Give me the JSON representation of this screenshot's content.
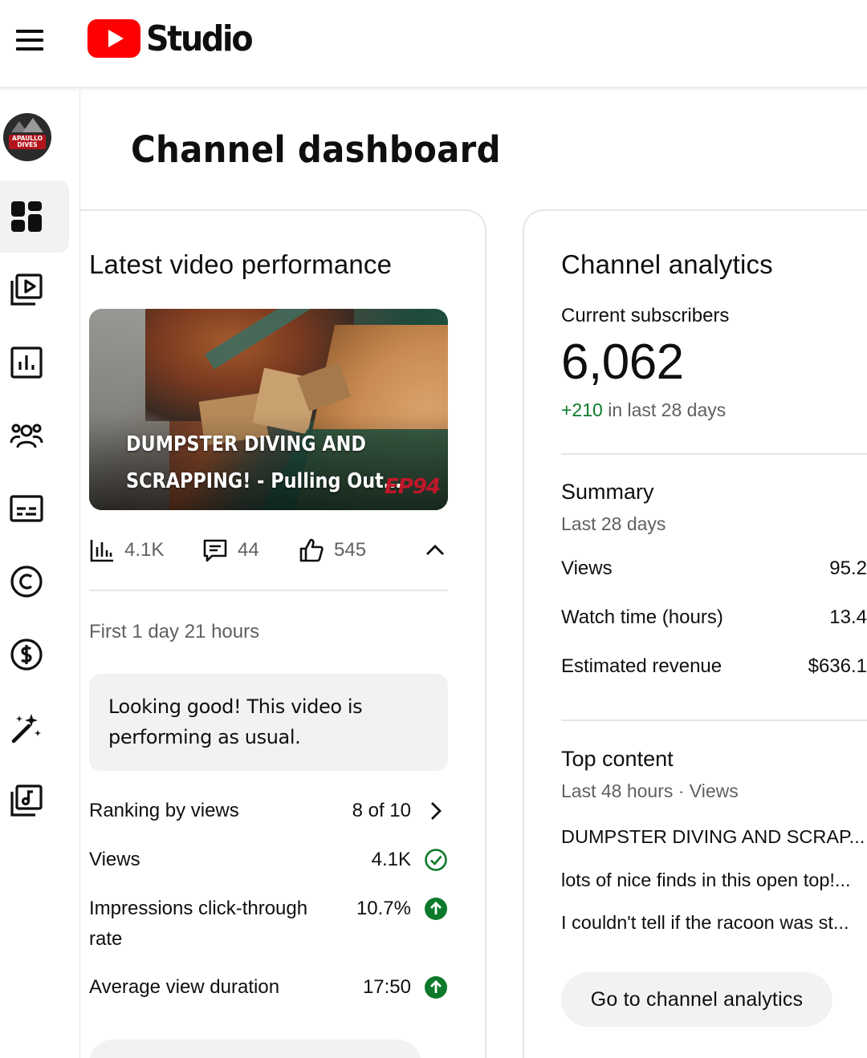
{
  "header": {
    "app_name": "Studio",
    "menu_icon": "hamburger-menu-icon",
    "logo_icon": "youtube-play-logo",
    "brand_color": "#ff0000"
  },
  "sidebar": {
    "avatar_text": "APAULLO DIVES",
    "items": [
      {
        "icon": "dashboard-icon",
        "active": true
      },
      {
        "icon": "content-icon"
      },
      {
        "icon": "analytics-icon"
      },
      {
        "icon": "community-icon"
      },
      {
        "icon": "subtitles-icon"
      },
      {
        "icon": "copyright-icon"
      },
      {
        "icon": "earn-icon"
      },
      {
        "icon": "customization-icon"
      },
      {
        "icon": "audio-library-icon"
      }
    ]
  },
  "page": {
    "title": "Channel dashboard"
  },
  "latest_video": {
    "title": "Latest video performance",
    "thumbnail_title_line1": "DUMPSTER DIVING AND",
    "thumbnail_title_line2": "SCRAPPING! - Pulling Out...",
    "thumbnail_badge": "EP94",
    "stats": {
      "views": "4.1K",
      "comments": "44",
      "likes": "545"
    },
    "period": "First 1 day 21 hours",
    "notice": "Looking good! This video is performing as usual.",
    "metrics": [
      {
        "label": "Ranking by views",
        "value": "8 of 10",
        "indicator": "chevron-right-icon"
      },
      {
        "label": "Views",
        "value": "4.1K",
        "indicator": "check-circle-icon"
      },
      {
        "label": "Impressions click-through rate",
        "value": "10.7%",
        "indicator": "arrow-up-circle-icon"
      },
      {
        "label": "Average view duration",
        "value": "17:50",
        "indicator": "arrow-up-circle-icon"
      }
    ],
    "positive_color": "#0c7a2a"
  },
  "channel_analytics": {
    "title": "Channel analytics",
    "subscribers_label": "Current subscribers",
    "subscribers_count": "6,062",
    "subscribers_change": "+210",
    "subscribers_change_suffix": " in last 28 days",
    "summary": {
      "title": "Summary",
      "period": "Last 28 days",
      "rows": [
        {
          "label": "Views",
          "value": "95.2"
        },
        {
          "label": "Watch time (hours)",
          "value": "13.4"
        },
        {
          "label": "Estimated revenue",
          "value": "$636.1"
        }
      ]
    },
    "top_content": {
      "title": "Top content",
      "period": "Last 48 hours · Views",
      "items": [
        "DUMPSTER DIVING AND SCRAP...",
        "lots of nice finds in this open top!...",
        "I couldn't tell if the racoon was st..."
      ]
    },
    "go_button": "Go to channel analytics"
  }
}
